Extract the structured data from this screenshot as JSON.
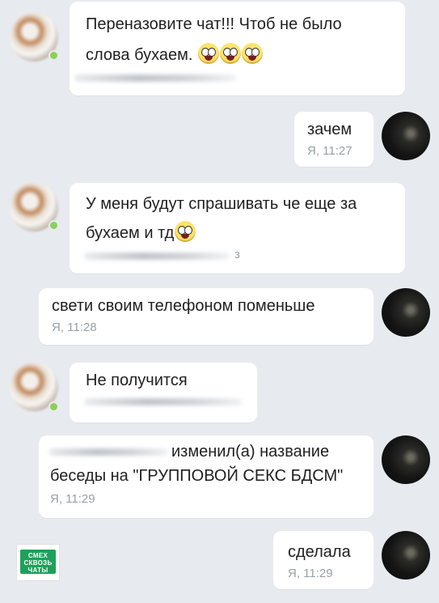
{
  "messages": [
    {
      "sender": "friend",
      "lines": [
        "Переназовите чат!!! Чтоб не было",
        "слова бухаем."
      ],
      "emoji": [
        "astonished-face-icon",
        "astonished-face-icon",
        "astonished-face-icon"
      ]
    },
    {
      "sender": "me",
      "lines": [
        "зачем"
      ],
      "meta": "Я, 11:27"
    },
    {
      "sender": "friend",
      "lines": [
        "У меня будут спрашивать че еще за",
        "бухаем и тд"
      ],
      "emoji": [
        "astonished-face-icon"
      ],
      "meta_partial": "з"
    },
    {
      "sender": "me",
      "lines": [
        "свети своим телефоном поменьше"
      ],
      "meta": "Я, 11:28"
    },
    {
      "sender": "friend",
      "lines": [
        "Не получится"
      ]
    },
    {
      "sender": "me",
      "lines": [
        "изменил(а) название",
        "беседы на \"ГРУППОВОЙ СЕКС БДСМ\""
      ],
      "meta": "Я, 11:29"
    },
    {
      "sender": "me",
      "lines": [
        "сделала"
      ],
      "meta": "Я, 11:29"
    }
  ],
  "watermark": {
    "line1": "СМЕХ",
    "line2": "СКВОЗЬ",
    "line3": "ЧАТЫ",
    "color": "#1fa05a"
  },
  "colors": {
    "background": "#e7eaee",
    "bubble": "#ffffff",
    "meta": "#9aa0a6",
    "online": "#8bd056"
  }
}
